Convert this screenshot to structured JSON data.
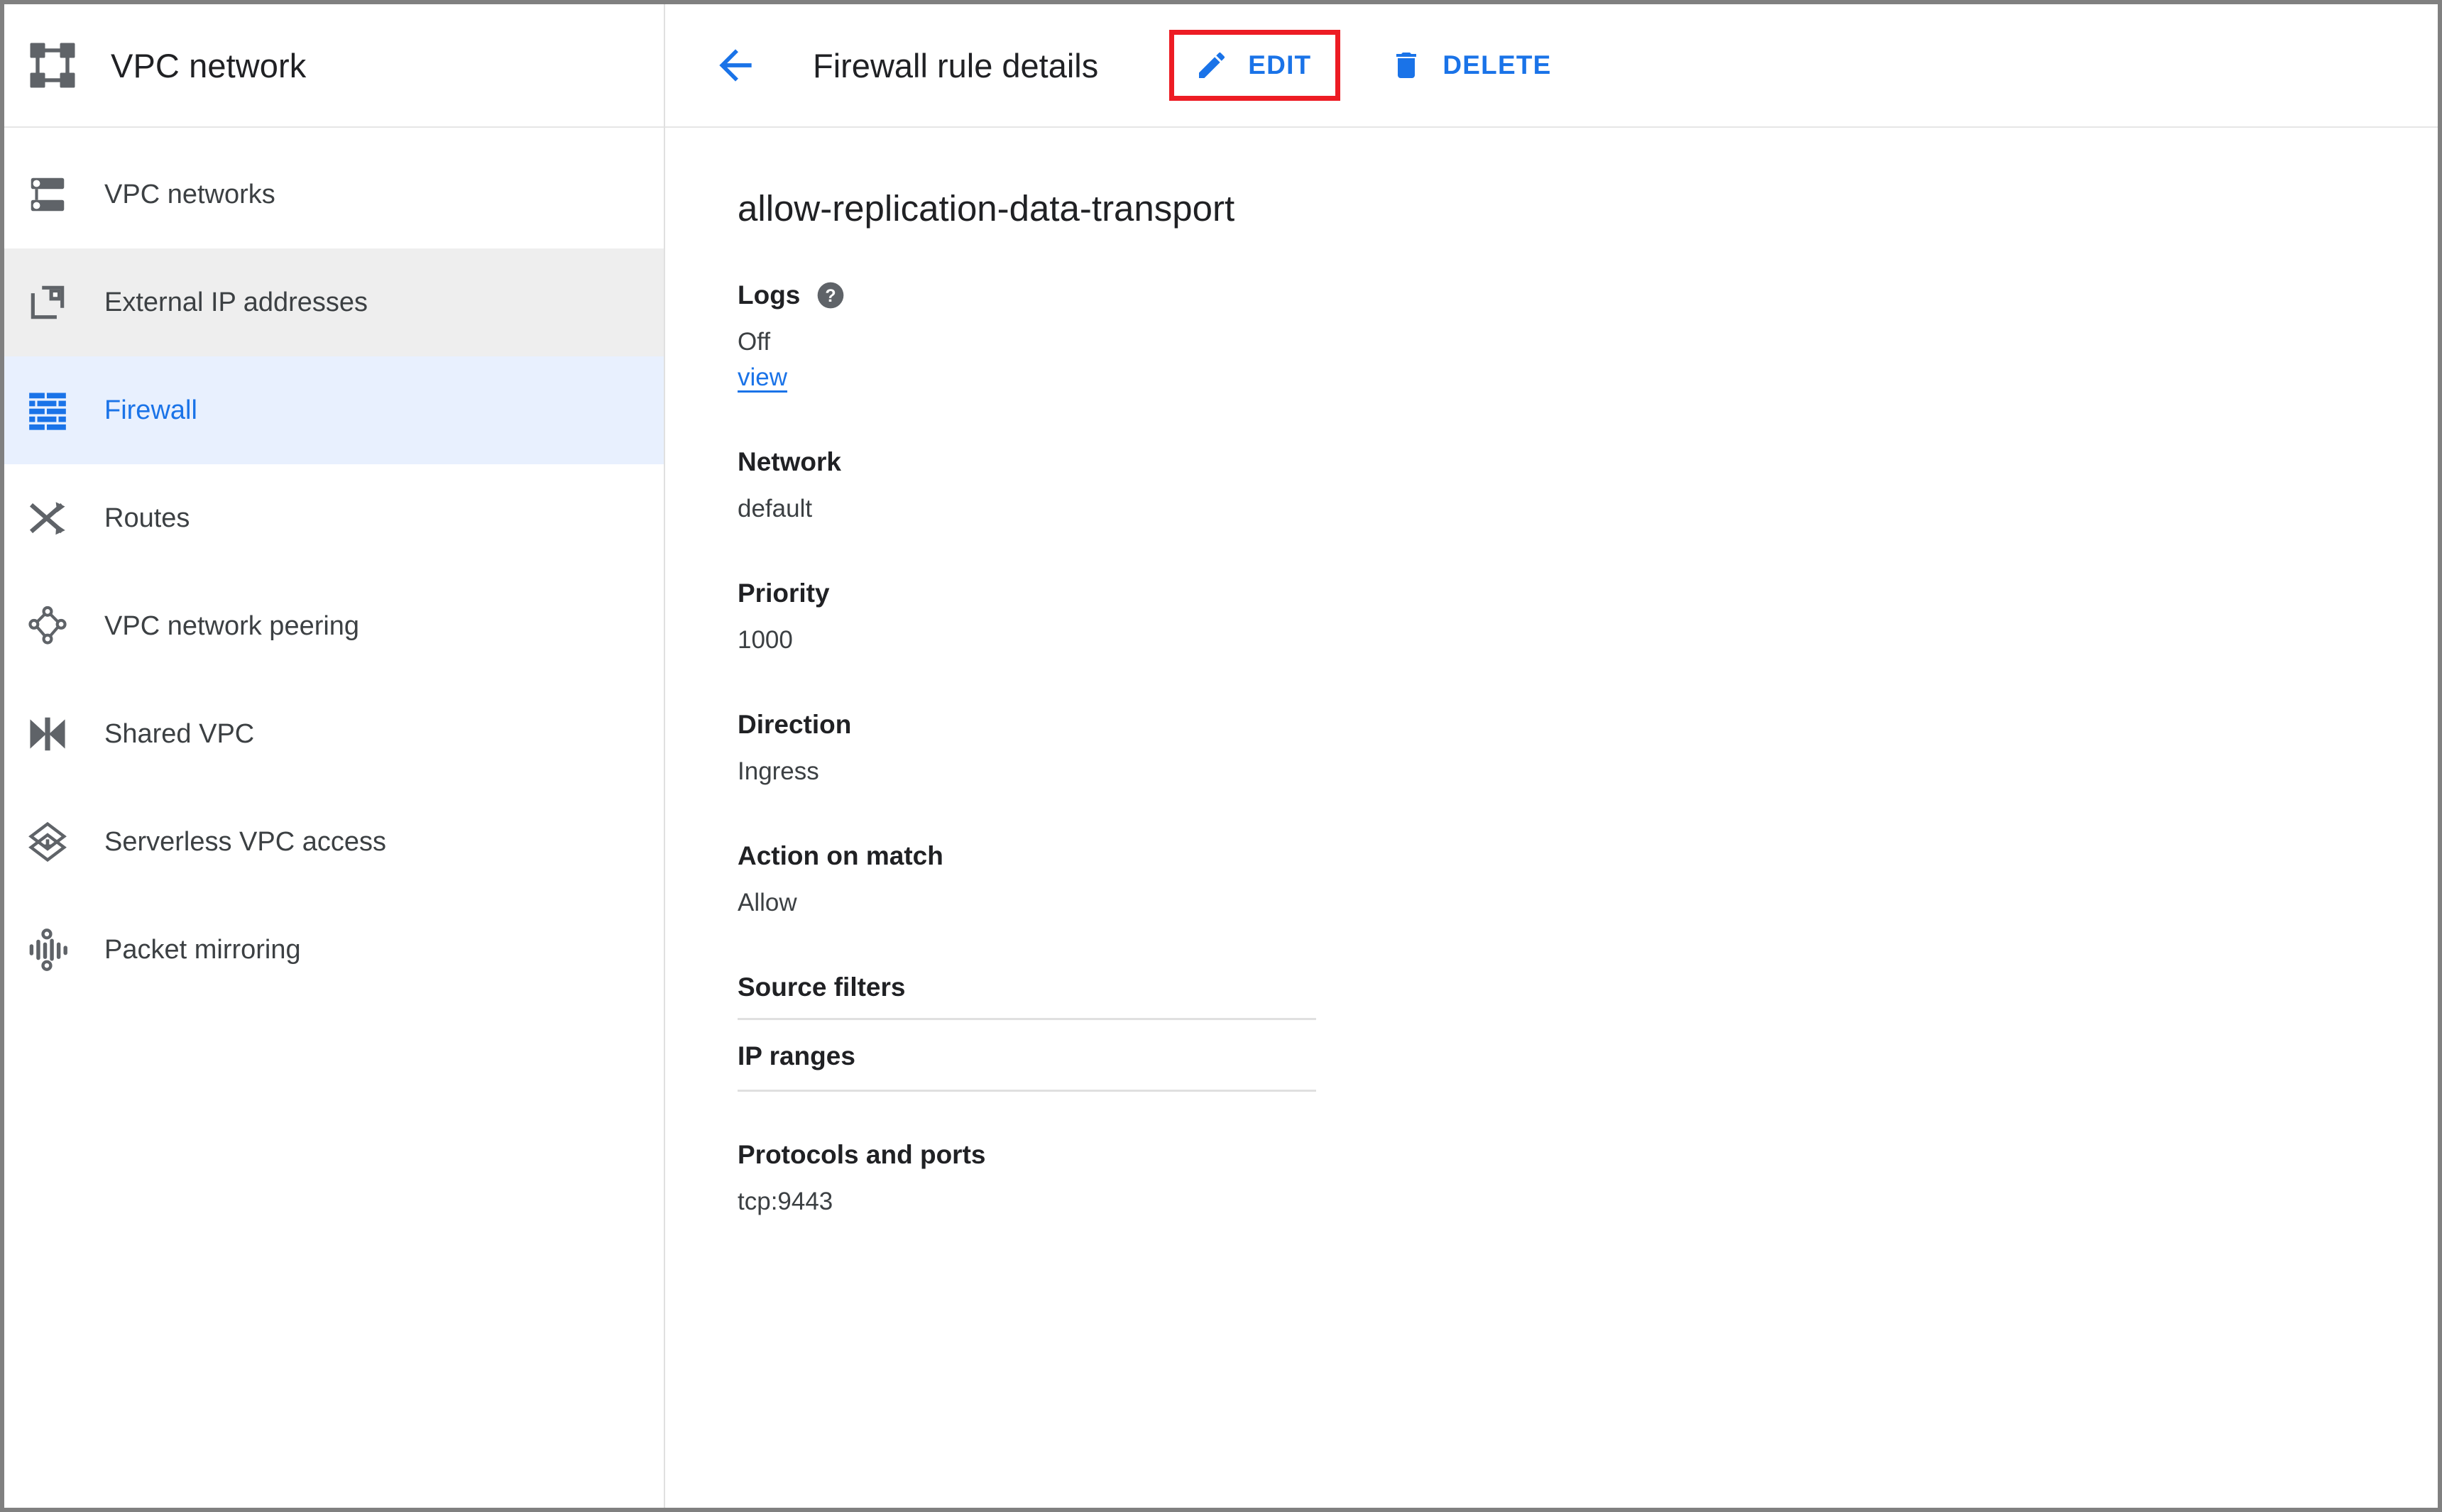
{
  "colors": {
    "accent_blue": "#1a73e8",
    "highlight_red": "#ed1c24",
    "selected_bg": "#e8f0fe",
    "hover_bg": "#eeeeee",
    "icon_gray": "#5f6368",
    "text_primary": "#202124",
    "text_secondary": "#3c4043",
    "divider": "#e0e0e0"
  },
  "sidebar": {
    "logo_icon": "vpc-network-logo-icon",
    "title": "VPC network",
    "items": [
      {
        "label": "VPC networks",
        "icon": "vpc-networks-icon",
        "state": "default"
      },
      {
        "label": "External IP addresses",
        "icon": "external-ip-icon",
        "state": "hovered"
      },
      {
        "label": "Firewall",
        "icon": "firewall-brick-icon",
        "state": "selected"
      },
      {
        "label": "Routes",
        "icon": "routes-icon",
        "state": "default"
      },
      {
        "label": "VPC network peering",
        "icon": "vpc-peering-icon",
        "state": "default"
      },
      {
        "label": "Shared VPC",
        "icon": "shared-vpc-icon",
        "state": "default"
      },
      {
        "label": "Serverless VPC access",
        "icon": "serverless-vpc-icon",
        "state": "default"
      },
      {
        "label": "Packet mirroring",
        "icon": "packet-mirroring-icon",
        "state": "default"
      }
    ]
  },
  "header": {
    "back_icon": "back-arrow-icon",
    "title": "Firewall rule details",
    "edit": {
      "label": "EDIT",
      "icon": "pencil-edit-icon",
      "highlighted": true
    },
    "delete": {
      "label": "DELETE",
      "icon": "trash-delete-icon",
      "highlighted": false
    }
  },
  "detail": {
    "rule_name": "allow-replication-data-transport",
    "logs": {
      "label": "Logs",
      "help_icon": "help-question-icon",
      "value": "Off",
      "link": "view"
    },
    "network": {
      "label": "Network",
      "value": "default"
    },
    "priority": {
      "label": "Priority",
      "value": "1000"
    },
    "direction": {
      "label": "Direction",
      "value": "Ingress"
    },
    "action_on_match": {
      "label": "Action on match",
      "value": "Allow"
    },
    "source_filters": {
      "label": "Source filters",
      "columns": [
        "IP ranges"
      ],
      "rows": []
    },
    "protocols_and_ports": {
      "label": "Protocols and ports",
      "value": "tcp:9443"
    }
  }
}
